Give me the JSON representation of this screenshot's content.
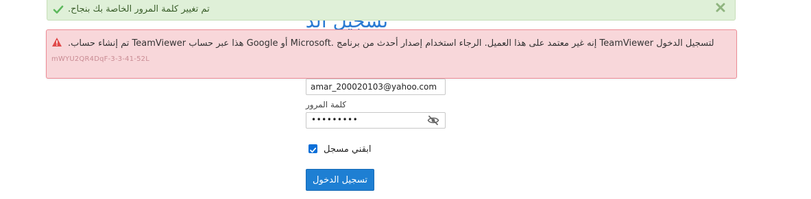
{
  "page": {
    "heading": "تسجيل الدخول"
  },
  "success_banner": {
    "message": "تم تغيير كلمة المرور الخاصة بك بنجاح."
  },
  "error_banner": {
    "message": "لتسجيل الدخول TeamViewer إنه غير معتمد على هذا العميل. الرجاء استخدام إصدار أحدث من برنامج .Microsoft أو Google هذا عبر حساب TeamViewer تم إنشاء حساب.",
    "code": "mWYU2QR4DqF-3-3-41-52L"
  },
  "login_form": {
    "email_value": "amar_200020103@yahoo.com",
    "password_label": "كلمة المرور",
    "password_mask": "•••••••••",
    "remember_label": "ابقني مسجل",
    "remember_checked": true,
    "submit_label": "تسجيل الدخول"
  },
  "icons": {
    "success": "check-icon",
    "close": "close-icon",
    "warning": "warning-icon",
    "eye": "eye-slash-icon"
  },
  "colors": {
    "accent": "#1e7fd3",
    "success_bg": "#dff0d8",
    "error_bg": "#f8d7da",
    "error_border": "#ed8b95"
  }
}
